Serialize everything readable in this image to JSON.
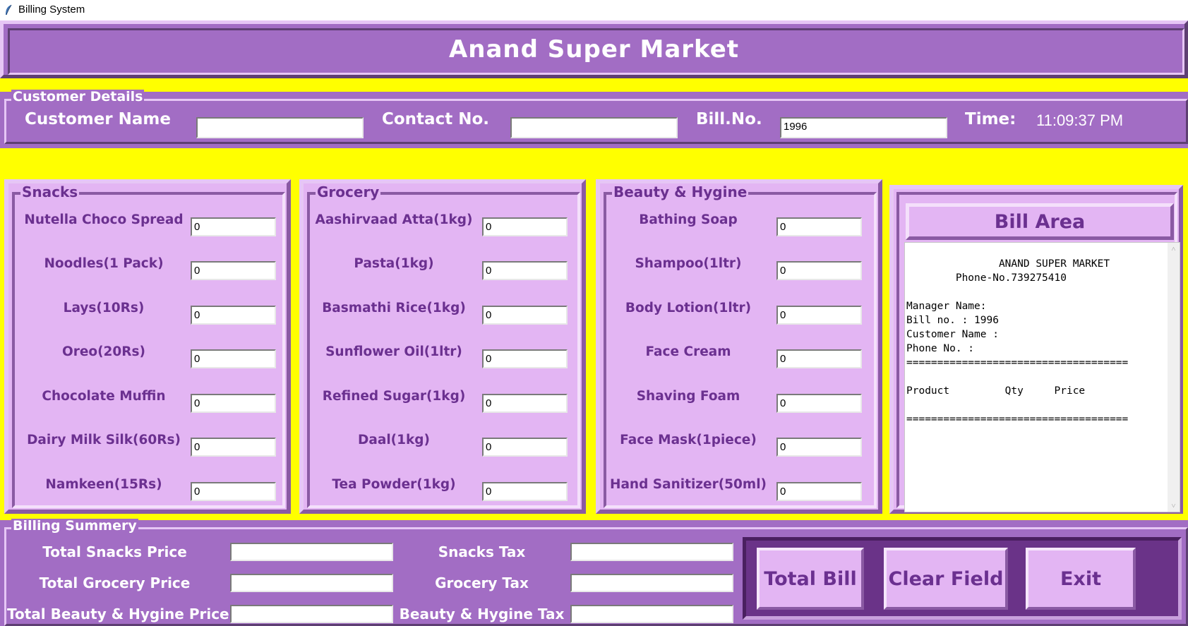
{
  "window": {
    "title": "Billing System"
  },
  "header": {
    "title": "Anand Super Market"
  },
  "customer": {
    "legend": "Customer Details",
    "name_label": "Customer Name",
    "name_value": "",
    "contact_label": "Contact No.",
    "contact_value": "",
    "bill_label": "Bill.No.",
    "bill_value": "1996",
    "time_label": "Time:",
    "time_value": "11:09:37 PM"
  },
  "snacks": {
    "legend": "Snacks",
    "items": [
      {
        "label": "Nutella Choco Spread",
        "qty": "0"
      },
      {
        "label": "Noodles(1 Pack)",
        "qty": "0"
      },
      {
        "label": "Lays(10Rs)",
        "qty": "0"
      },
      {
        "label": "Oreo(20Rs)",
        "qty": "0"
      },
      {
        "label": "Chocolate Muffin",
        "qty": "0"
      },
      {
        "label": "Dairy Milk Silk(60Rs)",
        "qty": "0"
      },
      {
        "label": "Namkeen(15Rs)",
        "qty": "0"
      }
    ]
  },
  "grocery": {
    "legend": "Grocery",
    "items": [
      {
        "label": "Aashirvaad Atta(1kg)",
        "qty": "0"
      },
      {
        "label": "Pasta(1kg)",
        "qty": "0"
      },
      {
        "label": "Basmathi Rice(1kg)",
        "qty": "0"
      },
      {
        "label": "Sunflower Oil(1ltr)",
        "qty": "0"
      },
      {
        "label": "Refined Sugar(1kg)",
        "qty": "0"
      },
      {
        "label": "Daal(1kg)",
        "qty": "0"
      },
      {
        "label": "Tea Powder(1kg)",
        "qty": "0"
      }
    ]
  },
  "beauty": {
    "legend": "Beauty & Hygine",
    "items": [
      {
        "label": "Bathing Soap",
        "qty": "0"
      },
      {
        "label": "Shampoo(1ltr)",
        "qty": "0"
      },
      {
        "label": "Body Lotion(1ltr)",
        "qty": "0"
      },
      {
        "label": "Face Cream",
        "qty": "0"
      },
      {
        "label": "Shaving Foam",
        "qty": "0"
      },
      {
        "label": "Face Mask(1piece)",
        "qty": "0"
      },
      {
        "label": "Hand Sanitizer(50ml)",
        "qty": "0"
      }
    ]
  },
  "bill_area": {
    "title": "Bill Area",
    "text": "           ANAND SUPER MARKET\n        Phone-No.739275410\n\nManager Name:\nBill no. : 1996\nCustomer Name :\nPhone No. :\n====================================\n\nProduct         Qty     Price\n\n===================================="
  },
  "summary": {
    "legend": "Billing Summery",
    "total_snacks_label": "Total Snacks Price",
    "total_grocery_label": "Total Grocery Price",
    "total_beauty_label": "Total Beauty & Hygine Price",
    "snacks_tax_label": "Snacks Tax",
    "grocery_tax_label": "Grocery Tax",
    "beauty_tax_label": "Beauty & Hygine Tax",
    "total_snacks_value": "",
    "total_grocery_value": "",
    "total_beauty_value": "",
    "snacks_tax_value": "",
    "grocery_tax_value": "",
    "beauty_tax_value": ""
  },
  "buttons": {
    "total_bill": "Total Bill",
    "clear_field": "Clear Field",
    "exit": "Exit"
  }
}
